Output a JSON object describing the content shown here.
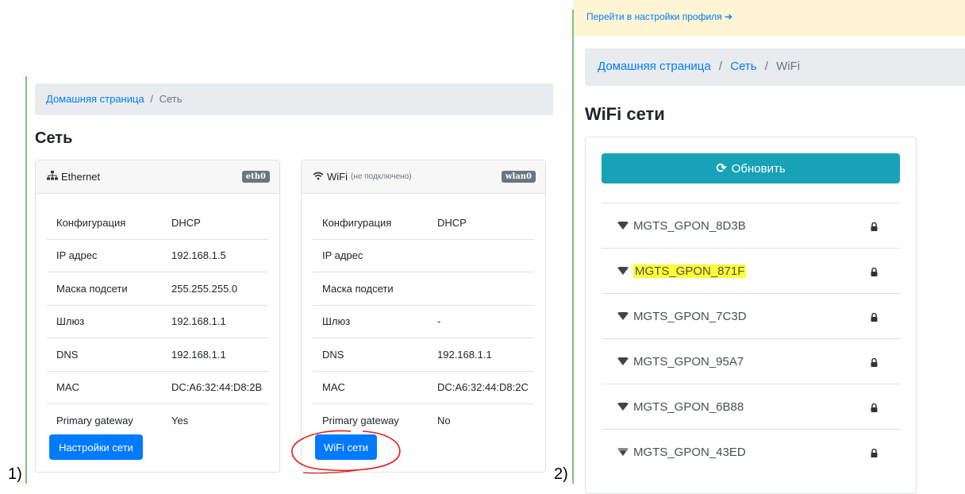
{
  "markers": {
    "panel1": "1)",
    "panel2": "2)"
  },
  "panel1": {
    "breadcrumb": {
      "home": "Домашняя страница",
      "separator": "/",
      "current": "Сеть"
    },
    "title": "Сеть",
    "ethernet": {
      "title": "Ethernet",
      "badge": "eth0",
      "rows": [
        {
          "key": "Конфигурация",
          "value": "DHCP"
        },
        {
          "key": "IP адрес",
          "value": "192.168.1.5"
        },
        {
          "key": "Маска подсети",
          "value": "255.255.255.0"
        },
        {
          "key": "Шлюз",
          "value": "192.168.1.1"
        },
        {
          "key": "DNS",
          "value": "192.168.1.1"
        },
        {
          "key": "MAC",
          "value": "DC:A6:32:44:D8:2B"
        },
        {
          "key": "Primary gateway",
          "value": "Yes"
        }
      ],
      "button": "Настройки сети"
    },
    "wifi": {
      "title": "WiFi",
      "status": "(не подключено)",
      "badge": "wlan0",
      "rows": [
        {
          "key": "Конфигурация",
          "value": "DHCP"
        },
        {
          "key": "IP адрес",
          "value": ""
        },
        {
          "key": "Маска подсети",
          "value": ""
        },
        {
          "key": "Шлюз",
          "value": "-"
        },
        {
          "key": "DNS",
          "value": "192.168.1.1"
        },
        {
          "key": "MAC",
          "value": "DC:A6:32:44:D8:2C"
        },
        {
          "key": "Primary gateway",
          "value": "No"
        }
      ],
      "button": "WiFi сети"
    }
  },
  "panel2": {
    "notice_link": "Перейти в настройки профиля",
    "breadcrumb": {
      "home": "Домашняя страница",
      "separator1": "/",
      "mid": "Сеть",
      "separator2": "/",
      "current": "WiFi"
    },
    "title": "WiFi сети",
    "refresh_button": "Обновить",
    "networks": [
      {
        "ssid": "MGTS_GPON_8D3B",
        "secured": true,
        "highlighted": false
      },
      {
        "ssid": "MGTS_GPON_871F",
        "secured": true,
        "highlighted": true
      },
      {
        "ssid": "MGTS_GPON_7C3D",
        "secured": true,
        "highlighted": false
      },
      {
        "ssid": "MGTS_GPON_95A7",
        "secured": true,
        "highlighted": false
      },
      {
        "ssid": "MGTS_GPON_6B88",
        "secured": true,
        "highlighted": false
      },
      {
        "ssid": "MGTS_GPON_43ED",
        "secured": true,
        "highlighted": false
      }
    ]
  },
  "colors": {
    "primary": "#007bff",
    "info": "#17a2b8",
    "highlight": "#ffff33",
    "annotation": "#e0201b"
  }
}
